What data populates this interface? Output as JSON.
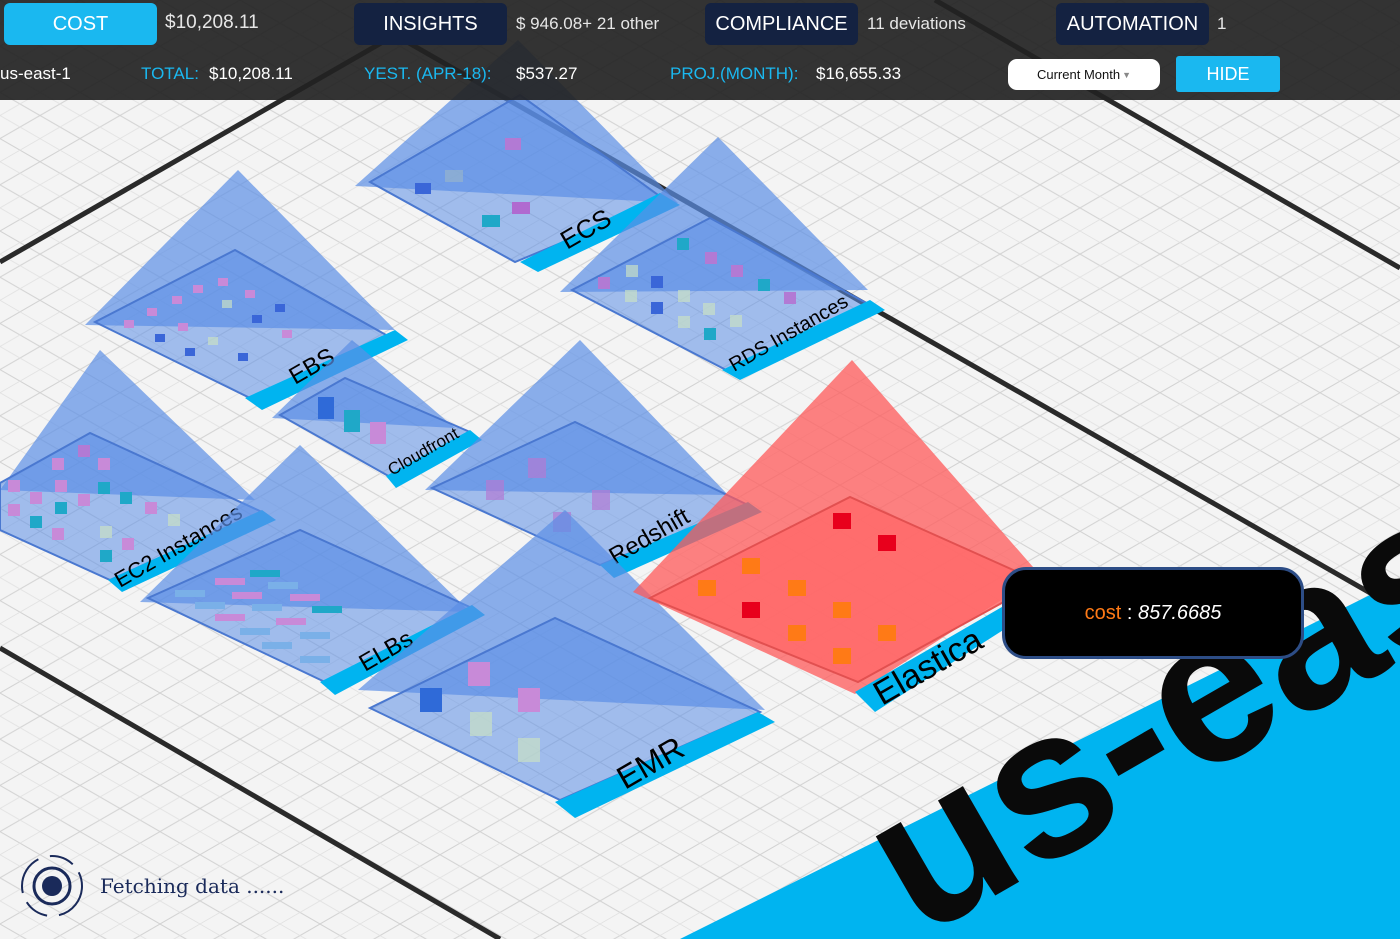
{
  "topbar": {
    "tabs": [
      {
        "label": "COST",
        "value": "$10,208.11"
      },
      {
        "label": "INSIGHTS",
        "value": "$ 946.08+ 21 other"
      },
      {
        "label": "COMPLIANCE",
        "value": "11 deviations"
      },
      {
        "label": "AUTOMATION",
        "value": "1"
      }
    ],
    "region": "us-east-1",
    "total_label": "TOTAL:",
    "total_value": "$10,208.11",
    "yest_label": "YEST. (APR-18):",
    "yest_value": "$537.27",
    "proj_label": "PROJ.(MONTH):",
    "proj_value": "$16,655.33",
    "period_select": "Current Month",
    "hide_label": "HIDE"
  },
  "scene": {
    "services": [
      {
        "name": "ECS",
        "label": "ECS"
      },
      {
        "name": "EBS",
        "label": "EBS"
      },
      {
        "name": "RDS Instances",
        "label": "RDS Instances"
      },
      {
        "name": "Cloudfront",
        "label": "Cloudfront"
      },
      {
        "name": "EC2 Instances",
        "label": "EC2 Instances"
      },
      {
        "name": "Redshift",
        "label": "Redshift"
      },
      {
        "name": "ELBs",
        "label": "ELBs"
      },
      {
        "name": "EMR",
        "label": "EMR"
      },
      {
        "name": "Elasticache",
        "label": "Elastica",
        "highlighted": true
      }
    ],
    "region_banner": "us-east",
    "colors": {
      "selected": "#ff5a5a",
      "service": "#5b8ee6",
      "accent": "#1ab8f0",
      "cube_red": "#e8001c",
      "cube_orange": "#ff7a16"
    }
  },
  "tooltip": {
    "key": "cost",
    "sep": " : ",
    "value": "857.6685"
  },
  "status": {
    "text": "Fetching data ......"
  }
}
